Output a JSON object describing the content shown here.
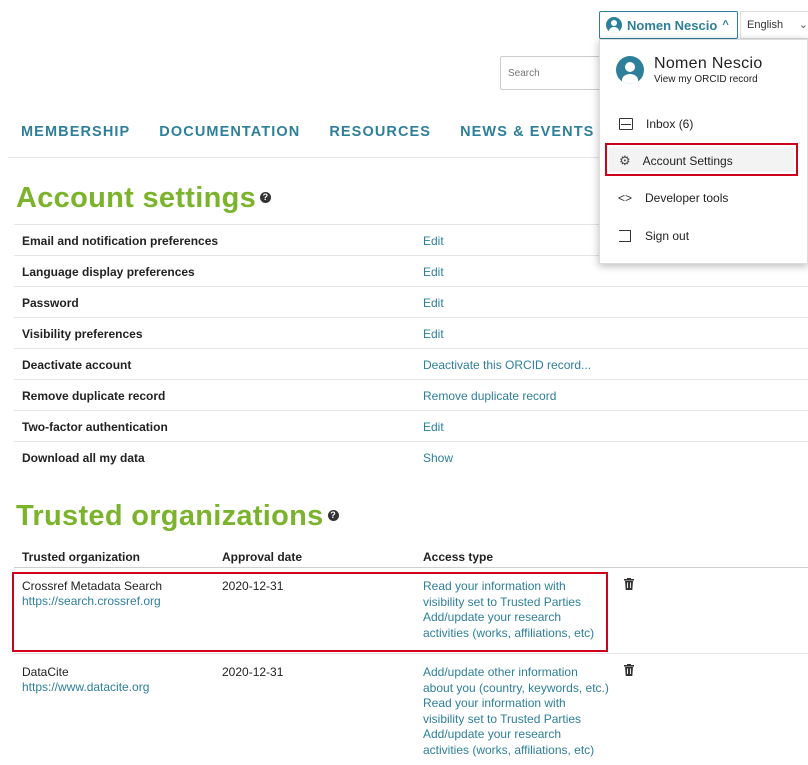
{
  "user_menu": {
    "name": "Nomen Nescio",
    "language": "English"
  },
  "search": {
    "placeholder": "Search"
  },
  "nav": {
    "items": [
      "MEMBERSHIP",
      "DOCUMENTATION",
      "RESOURCES",
      "NEWS & EVENTS"
    ]
  },
  "dropdown": {
    "name": "Nomen Nescio",
    "view_record": "View my ORCID record",
    "items": [
      {
        "label": "Inbox (6)",
        "icon": "inbox-icon"
      },
      {
        "label": "Account Settings",
        "icon": "gear-icon"
      },
      {
        "label": "Developer tools",
        "icon": "code-icon"
      },
      {
        "label": "Sign out",
        "icon": "sign-out-icon"
      }
    ]
  },
  "account_settings": {
    "title": "Account settings",
    "rows": [
      {
        "label": "Email and notification preferences",
        "action": "Edit"
      },
      {
        "label": "Language display preferences",
        "action": "Edit"
      },
      {
        "label": "Password",
        "action": "Edit"
      },
      {
        "label": "Visibility preferences",
        "action": "Edit"
      },
      {
        "label": "Deactivate account",
        "action": "Deactivate this ORCID record..."
      },
      {
        "label": "Remove duplicate record",
        "action": "Remove duplicate record"
      },
      {
        "label": "Two-factor authentication",
        "action": "Edit"
      },
      {
        "label": "Download all my data",
        "action": "Show"
      }
    ]
  },
  "trusted_orgs": {
    "title": "Trusted organizations",
    "headers": [
      "Trusted organization",
      "Approval date",
      "Access type"
    ],
    "rows": [
      {
        "name": "Crossref Metadata Search",
        "url": "https://search.crossref.org",
        "date": "2020-12-31",
        "access": [
          "Read your information with",
          "visibility set to Trusted Parties",
          "Add/update your research",
          "activities (works, affiliations, etc)"
        ]
      },
      {
        "name": "DataCite",
        "url": "https://www.datacite.org",
        "date": "2020-12-31",
        "access": [
          "Add/update other information",
          "about you (country, keywords, etc.)",
          "Read your information with",
          "visibility set to Trusted Parties",
          "Add/update your research",
          "activities (works, affiliations, etc)"
        ]
      }
    ]
  },
  "colors": {
    "accent": "#2e7f9a",
    "heading": "#7bb42c",
    "highlight": "#d0021b"
  }
}
